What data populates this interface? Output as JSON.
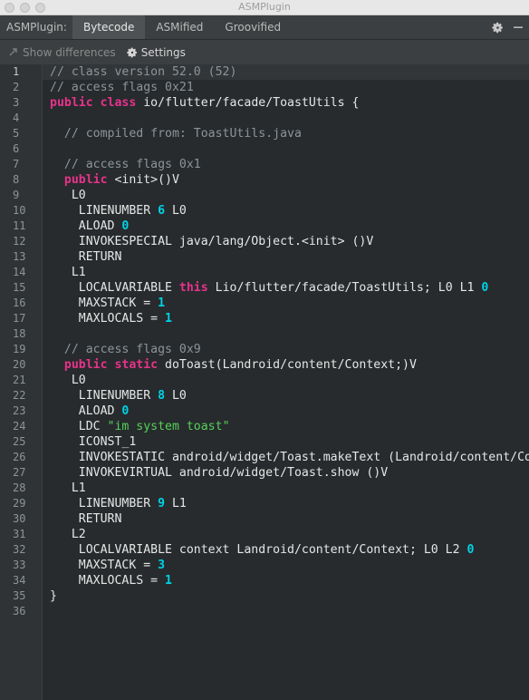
{
  "window": {
    "title": "ASMPlugin"
  },
  "tabs": {
    "label": "ASMPlugin:",
    "items": [
      "Bytecode",
      "ASMified",
      "Groovified"
    ],
    "active": 0
  },
  "toolbar": {
    "show_differences": "Show differences",
    "settings": "Settings"
  },
  "colors": {
    "keyword": "#e8328c",
    "number": "#00d2e6",
    "string": "#56d15a",
    "comment": "#8d949a",
    "background": "#272b2d"
  },
  "editor": {
    "current_line": 1,
    "lines": [
      [
        [
          "c",
          "// class version 52.0 (52)"
        ]
      ],
      [
        [
          "c",
          "// access flags 0x21"
        ]
      ],
      [
        [
          "k",
          "public class"
        ],
        [
          "p",
          " io/flutter/facade/ToastUtils {"
        ]
      ],
      [
        [
          "p",
          ""
        ]
      ],
      [
        [
          "c",
          "  // compiled from: ToastUtils.java"
        ]
      ],
      [
        [
          "p",
          ""
        ]
      ],
      [
        [
          "c",
          "  // access flags 0x1"
        ]
      ],
      [
        [
          "p",
          "  "
        ],
        [
          "k",
          "public"
        ],
        [
          "p",
          " <init>()V"
        ]
      ],
      [
        [
          "p",
          "   L0"
        ]
      ],
      [
        [
          "p",
          "    LINENUMBER "
        ],
        [
          "n",
          "6"
        ],
        [
          "p",
          " L0"
        ]
      ],
      [
        [
          "p",
          "    ALOAD "
        ],
        [
          "n",
          "0"
        ]
      ],
      [
        [
          "p",
          "    INVOKESPECIAL java/lang/Object.<init> ()V"
        ]
      ],
      [
        [
          "p",
          "    RETURN"
        ]
      ],
      [
        [
          "p",
          "   L1"
        ]
      ],
      [
        [
          "p",
          "    LOCALVARIABLE "
        ],
        [
          "k",
          "this"
        ],
        [
          "p",
          " Lio/flutter/facade/ToastUtils; L0 L1 "
        ],
        [
          "n",
          "0"
        ]
      ],
      [
        [
          "p",
          "    MAXSTACK = "
        ],
        [
          "n",
          "1"
        ]
      ],
      [
        [
          "p",
          "    MAXLOCALS = "
        ],
        [
          "n",
          "1"
        ]
      ],
      [
        [
          "p",
          ""
        ]
      ],
      [
        [
          "c",
          "  // access flags 0x9"
        ]
      ],
      [
        [
          "p",
          "  "
        ],
        [
          "k",
          "public static"
        ],
        [
          "p",
          " doToast(Landroid/content/Context;)V"
        ]
      ],
      [
        [
          "p",
          "   L0"
        ]
      ],
      [
        [
          "p",
          "    LINENUMBER "
        ],
        [
          "n",
          "8"
        ],
        [
          "p",
          " L0"
        ]
      ],
      [
        [
          "p",
          "    ALOAD "
        ],
        [
          "n",
          "0"
        ]
      ],
      [
        [
          "p",
          "    LDC "
        ],
        [
          "s",
          "\"im system toast\""
        ]
      ],
      [
        [
          "p",
          "    ICONST_1"
        ]
      ],
      [
        [
          "p",
          "    INVOKESTATIC android/widget/Toast.makeText (Landroid/content/Co"
        ]
      ],
      [
        [
          "p",
          "    INVOKEVIRTUAL android/widget/Toast.show ()V"
        ]
      ],
      [
        [
          "p",
          "   L1"
        ]
      ],
      [
        [
          "p",
          "    LINENUMBER "
        ],
        [
          "n",
          "9"
        ],
        [
          "p",
          " L1"
        ]
      ],
      [
        [
          "p",
          "    RETURN"
        ]
      ],
      [
        [
          "p",
          "   L2"
        ]
      ],
      [
        [
          "p",
          "    LOCALVARIABLE context Landroid/content/Context; L0 L2 "
        ],
        [
          "n",
          "0"
        ]
      ],
      [
        [
          "p",
          "    MAXSTACK = "
        ],
        [
          "n",
          "3"
        ]
      ],
      [
        [
          "p",
          "    MAXLOCALS = "
        ],
        [
          "n",
          "1"
        ]
      ],
      [
        [
          "p",
          "}"
        ]
      ],
      [
        [
          "p",
          ""
        ]
      ]
    ]
  }
}
